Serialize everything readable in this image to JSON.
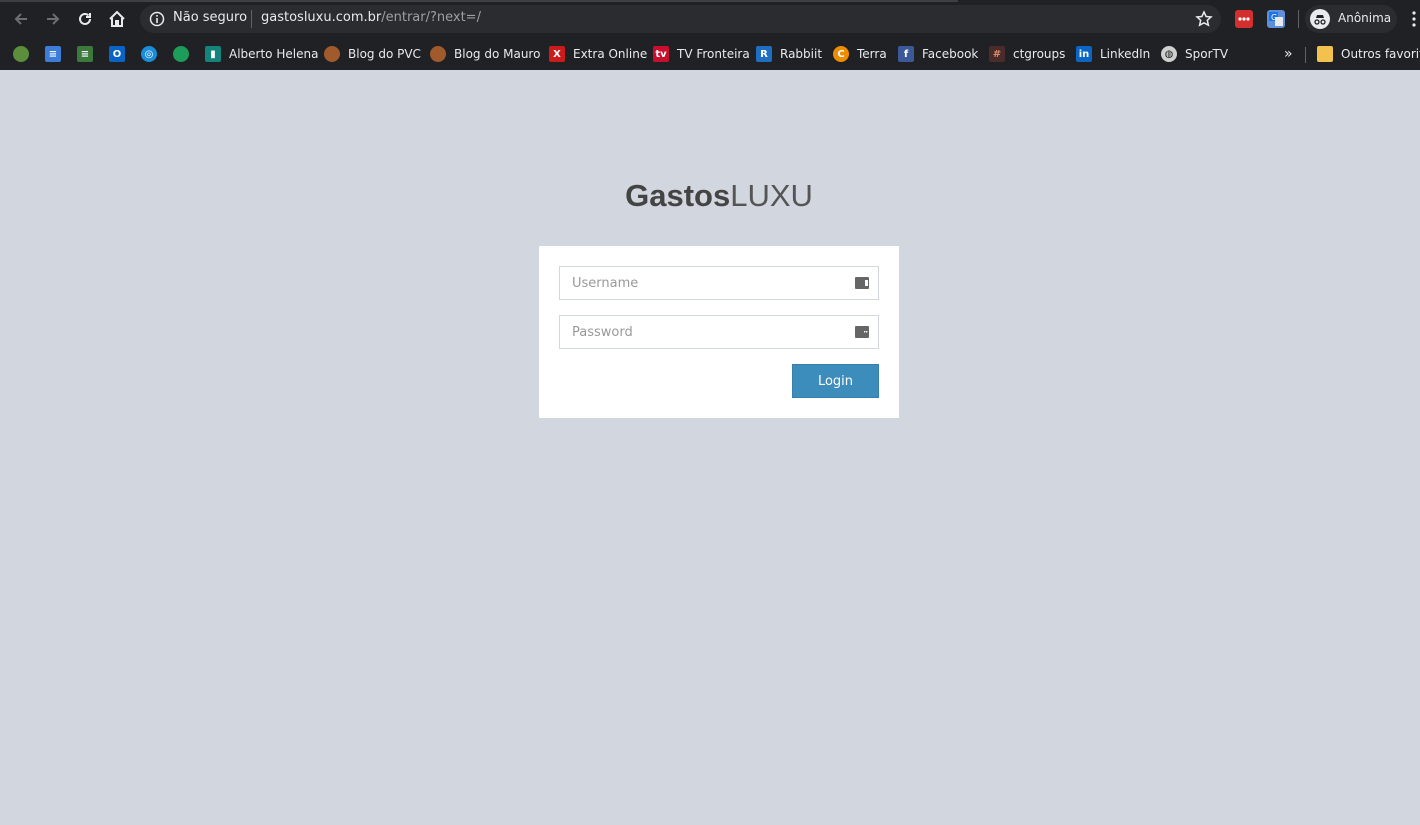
{
  "browser": {
    "security_label": "Não seguro",
    "url_host": "gastosluxu.com.br",
    "url_path": "/entrar/?next=/",
    "profile_label": "Anônima",
    "bookmarks": [
      {
        "label": "",
        "icon": "kiwi-icon",
        "color": "#5b8f3c"
      },
      {
        "label": "",
        "icon": "chat-icon",
        "color": "#3b7dd8"
      },
      {
        "label": "",
        "icon": "flag-icon",
        "color": "#3b7a3b"
      },
      {
        "label": "",
        "icon": "outlook-icon",
        "color": "#0a64c8"
      },
      {
        "label": "",
        "icon": "globo-icon",
        "color": "#1a8cd8"
      },
      {
        "label": "",
        "icon": "globe-green-icon",
        "color": "#1d9c5a"
      },
      {
        "label": "Alberto Helena",
        "icon": "ah-icon",
        "color": "#14837a"
      },
      {
        "label": "Blog do PVC",
        "icon": "football-icon",
        "color": "#a05a2c"
      },
      {
        "label": "Blog do Mauro",
        "icon": "football-icon",
        "color": "#a05a2c"
      },
      {
        "label": "Extra Online",
        "icon": "extra-icon",
        "color": "#cc1b1b"
      },
      {
        "label": "TV Fronteira",
        "icon": "tvf-icon",
        "color": "#c8102e"
      },
      {
        "label": "Rabbiit",
        "icon": "rabbiit-icon",
        "color": "#1e6fc4"
      },
      {
        "label": "Terra",
        "icon": "terra-icon",
        "color": "#f08c00"
      },
      {
        "label": "Facebook",
        "icon": "facebook-icon",
        "color": "#3b5998"
      },
      {
        "label": "ctgroups",
        "icon": "hash-icon",
        "color": "#4a2c2a"
      },
      {
        "label": "LinkedIn",
        "icon": "linkedin-icon",
        "color": "#0a66c2"
      },
      {
        "label": "SporTV",
        "icon": "globe-icon",
        "color": "#d0d0d0"
      }
    ],
    "more_bookmarks": "»",
    "other_favorites": "Outros favoritos"
  },
  "page": {
    "logo_bold": "Gastos",
    "logo_light": "LUXU",
    "username_placeholder": "Username",
    "password_placeholder": "Password",
    "login_label": "Login"
  },
  "colors": {
    "page_bg": "#d2d6de",
    "button": "#3c8dbc",
    "chrome": "#202124"
  }
}
